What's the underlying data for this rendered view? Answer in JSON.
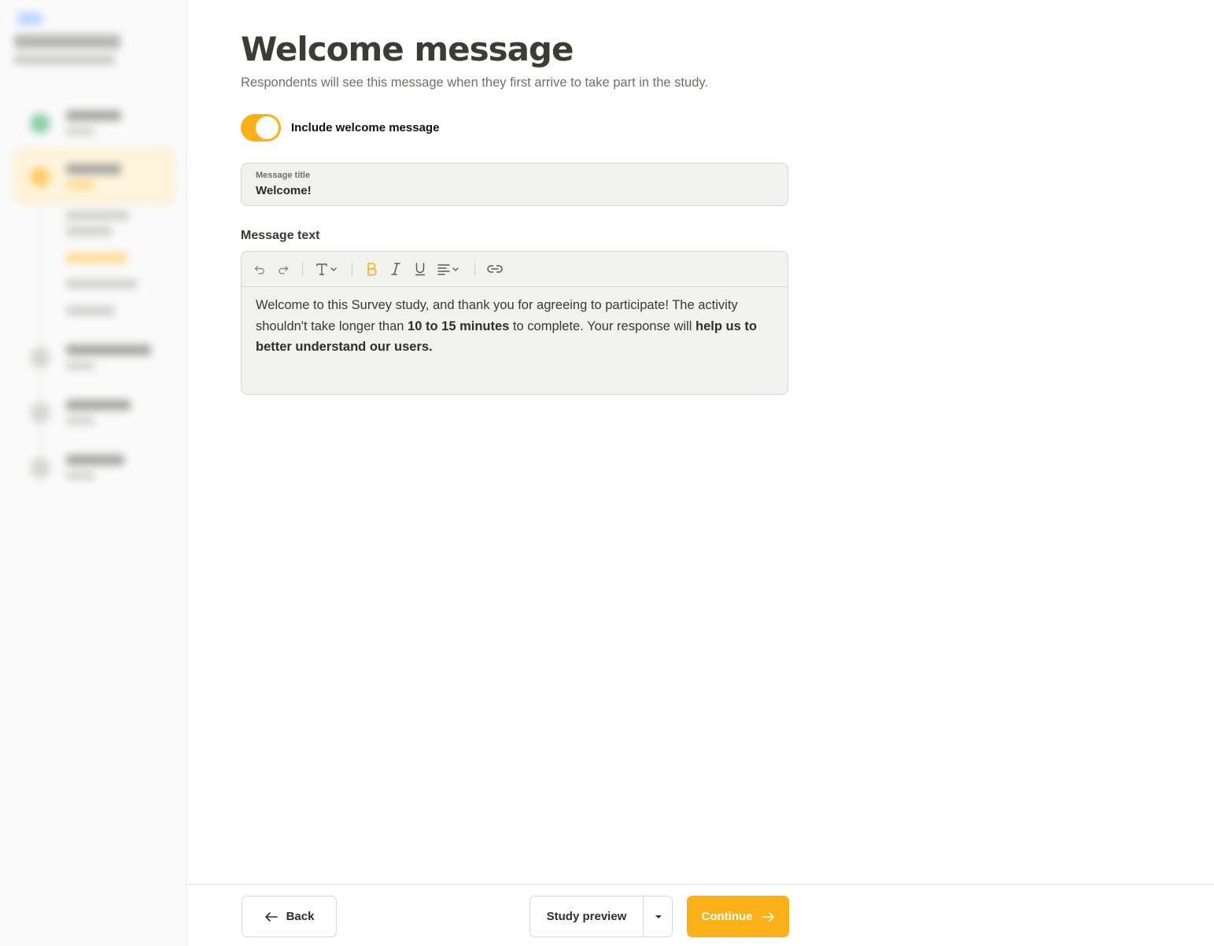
{
  "colors": {
    "accent": "#fbb018",
    "text": "#3a3a33",
    "muted": "#707068",
    "field_bg": "#f1f1ef"
  },
  "header": {
    "title": "Welcome message",
    "subtitle": "Respondents will see this message when they first arrive to take part in the study."
  },
  "toggle": {
    "label": "Include welcome message",
    "checked": true
  },
  "title_field": {
    "label": "Message title",
    "value": "Welcome!"
  },
  "editor": {
    "label": "Message text",
    "toolbar_icons": [
      "undo-icon",
      "redo-icon",
      "text-style-icon",
      "bold-icon",
      "italic-icon",
      "underline-icon",
      "align-icon",
      "link-icon"
    ],
    "body": [
      {
        "text": "Welcome to this Survey study, and thank you for agreeing to participate! The activity shouldn't take longer than ",
        "bold": false
      },
      {
        "text": "10 to 15 minutes",
        "bold": true
      },
      {
        "text": " to complete. Your response will ",
        "bold": false
      },
      {
        "text": "help us to better understand our users.",
        "bold": true
      }
    ]
  },
  "footer": {
    "back_label": "Back",
    "preview_label": "Study preview",
    "continue_label": "Continue"
  }
}
